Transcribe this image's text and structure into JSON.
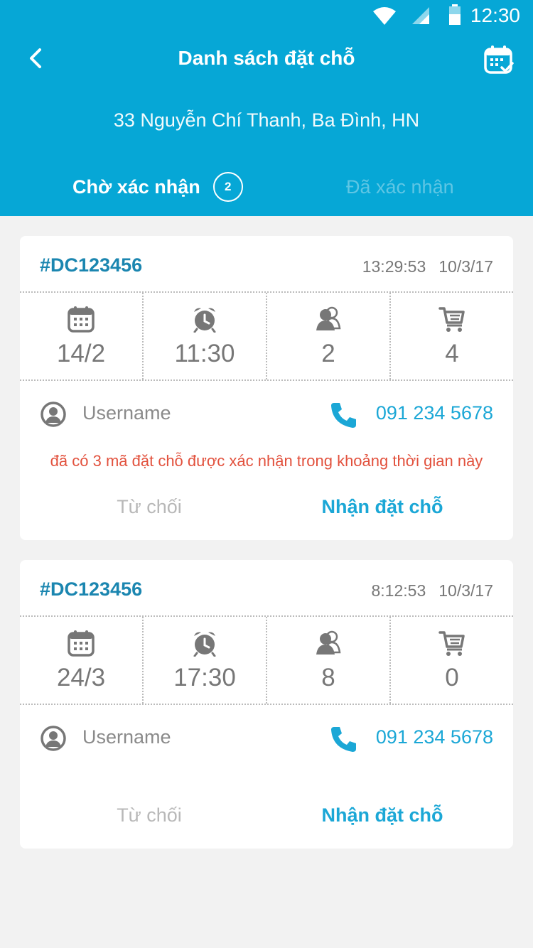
{
  "status_bar": {
    "time": "12:30"
  },
  "header": {
    "title": "Danh sách đặt chỗ",
    "address": "33 Nguyễn Chí Thanh, Ba Đình, HN"
  },
  "tabs": [
    {
      "label": "Chờ xác nhận",
      "badge": "2",
      "active": true
    },
    {
      "label": "Đã xác nhận",
      "active": false
    }
  ],
  "bookings": [
    {
      "code": "#DC123456",
      "time": "13:29:53",
      "date": "10/3/17",
      "stats": {
        "day": "14/2",
        "hour": "11:30",
        "guests": "2",
        "items": "4"
      },
      "username": "Username",
      "phone": "091 234 5678",
      "warning": "đã có 3 mã đặt chỗ được xác nhận trong khoảng thời gian này",
      "reject_label": "Từ chối",
      "accept_label": "Nhận đặt chỗ"
    },
    {
      "code": "#DC123456",
      "time": "8:12:53",
      "date": "10/3/17",
      "stats": {
        "day": "24/3",
        "hour": "17:30",
        "guests": "8",
        "items": "0"
      },
      "username": "Username",
      "phone": "091 234 5678",
      "reject_label": "Từ chối",
      "accept_label": "Nhận đặt chỗ"
    }
  ],
  "colors": {
    "header_bg": "#06a7d6",
    "code": "#1b86b0",
    "accent": "#1ba7d6",
    "warning": "#e2513d",
    "muted": "#b8b8b8"
  },
  "icons": {
    "status": [
      "wifi-icon",
      "signal-icon",
      "battery-icon"
    ],
    "header": [
      "back-icon",
      "calendar-check-icon"
    ],
    "stats": [
      "calendar-icon",
      "alarm-clock-icon",
      "people-icon",
      "cart-icon"
    ],
    "contact": [
      "user-circle-icon",
      "phone-icon"
    ]
  }
}
